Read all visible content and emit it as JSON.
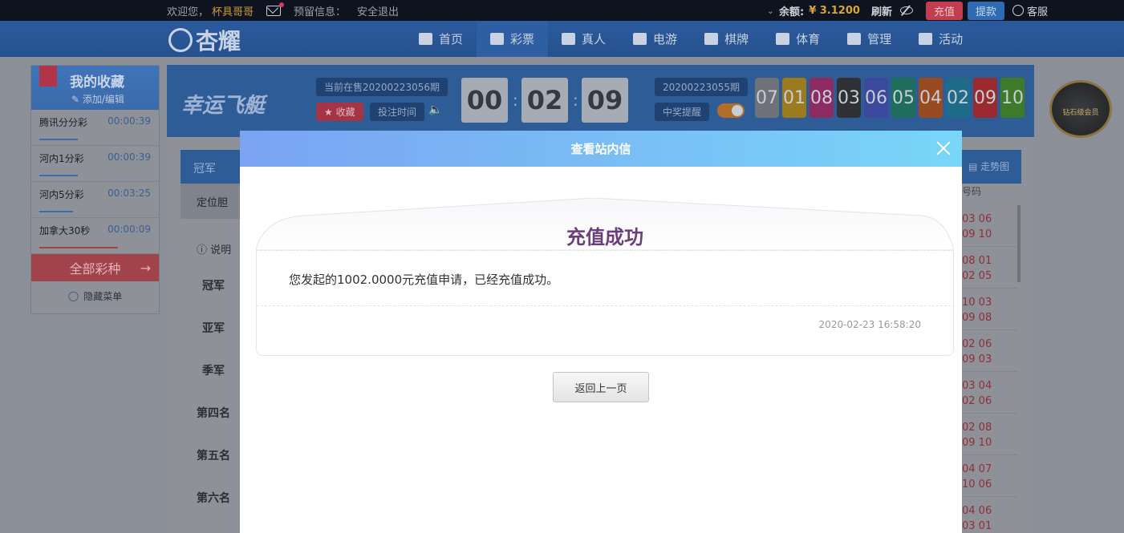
{
  "topbar": {
    "welcome": "欢迎您，",
    "username": "杯具哥哥",
    "notice_label": "预留信息：",
    "logout": "安全退出",
    "balance_label": "余额:",
    "balance_value": "¥ 3.1200",
    "refresh": "刷新",
    "recharge": "充值",
    "withdraw": "提款",
    "service": "客服"
  },
  "brand": {
    "logo_text": "杏耀"
  },
  "nav": {
    "items": [
      {
        "label": "首页",
        "icon": "home-icon"
      },
      {
        "label": "彩票",
        "icon": "ticket-icon"
      },
      {
        "label": "真人",
        "icon": "dealer-icon"
      },
      {
        "label": "电游",
        "icon": "slot-icon"
      },
      {
        "label": "棋牌",
        "icon": "cards-icon"
      },
      {
        "label": "体育",
        "icon": "trophy-icon"
      },
      {
        "label": "管理",
        "icon": "users-icon"
      },
      {
        "label": "活动",
        "icon": "gift-icon"
      }
    ]
  },
  "favorites": {
    "title": "我的收藏",
    "edit": "添加/编辑",
    "items": [
      {
        "name": "腾讯分分彩",
        "time": "00:00:39",
        "progress": 0.46
      },
      {
        "name": "河内1分彩",
        "time": "00:00:39",
        "progress": 0.46
      },
      {
        "name": "河内5分彩",
        "time": "00:03:25",
        "progress": 0.4
      },
      {
        "name": "加拿大30秒",
        "time": "00:00:09",
        "progress": 0.7
      }
    ],
    "all_lotteries": "全部彩种",
    "hide_menu": "隐藏菜单"
  },
  "game": {
    "title": "幸运飞艇",
    "current_issue": "当前在售20200223056期",
    "favorite": "收藏",
    "bet_time": "投注时间",
    "countdown": [
      "00",
      "02",
      "09"
    ],
    "last_issue": "20200223055期",
    "win_alert": "中奖提醒",
    "results": [
      {
        "num": "07",
        "color": "#6f7379"
      },
      {
        "num": "01",
        "color": "#9c7a1e"
      },
      {
        "num": "08",
        "color": "#8e2b63"
      },
      {
        "num": "03",
        "color": "#2f3135"
      },
      {
        "num": "06",
        "color": "#3b4a9c"
      },
      {
        "num": "05",
        "color": "#1f6d5c"
      },
      {
        "num": "04",
        "color": "#9a4a20"
      },
      {
        "num": "02",
        "color": "#1e6b8a"
      },
      {
        "num": "09",
        "color": "#9a2a2e"
      },
      {
        "num": "10",
        "color": "#3d7a2a"
      }
    ]
  },
  "badge": {
    "text": "钻石级会员"
  },
  "background": {
    "tab": "冠军",
    "trend": "走势图",
    "position": "定位胆",
    "desc": "说明",
    "ranks": [
      "冠军",
      "亚军",
      "季军",
      "第四名",
      "第五名",
      "第六名"
    ],
    "codes_header": "号码",
    "codes": [
      [
        "03 06",
        "09 10"
      ],
      [
        "08 01",
        "02 05"
      ],
      [
        "10 03",
        "09 08"
      ],
      [
        "02 06",
        "09 03"
      ],
      [
        "03 04",
        "02 06"
      ],
      [
        "02 08",
        "09 10"
      ],
      [
        "04 07",
        "10 06"
      ],
      [
        "04 06",
        "03 01"
      ]
    ]
  },
  "modal": {
    "title": "查看站内信",
    "message_title": "充值成功",
    "message_body": "您发起的1002.0000元充值申请，已经充值成功。",
    "timestamp": "2020-02-23 16:58:20",
    "back_button": "返回上一页"
  }
}
